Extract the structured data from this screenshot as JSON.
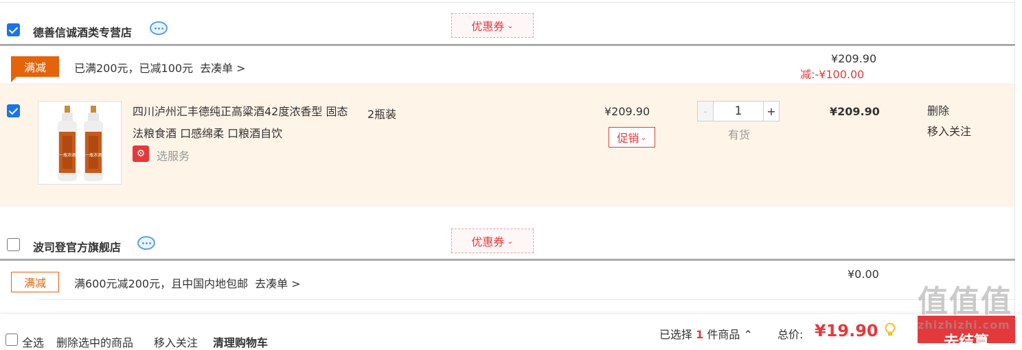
{
  "shops": [
    {
      "name": "德善信诚酒类专营店",
      "checked": true,
      "coupon_label": "优惠券",
      "promo": {
        "tag": "满减",
        "text": "已满200元，已减100元",
        "link": "去凑单 >",
        "subtotal": "¥209.90",
        "discount_label": "减:",
        "discount_value": "-¥100.00"
      },
      "item": {
        "checked": true,
        "name": "四川泸州汇丰德纯正高粱酒42度浓香型 固态法粮食酒 口感绵柔 口粮酒自饮",
        "service_label": "选服务",
        "spec": "2瓶装",
        "unit_price": "¥209.90",
        "promo_button": "促销",
        "quantity": "1",
        "dec": "-",
        "inc": "+",
        "stock": "有货",
        "sum": "¥209.90",
        "delete": "删除",
        "move_follow": "移入关注",
        "bottle_label": "一瓶浓酒"
      }
    },
    {
      "name": "波司登官方旗舰店",
      "checked": false,
      "coupon_label": "优惠券",
      "promo": {
        "tag": "满减",
        "text": "满600元减200元，且中国内地包邮",
        "link": "去凑单 >",
        "subtotal": "¥0.00"
      }
    }
  ],
  "footer": {
    "select_all": "全选",
    "delete_selected": "删除选中的商品",
    "move_follow": "移入关注",
    "clear_cart": "清理购物车",
    "selected_prefix": "已选择",
    "selected_count": "1",
    "selected_suffix": "件商品",
    "total_label": "总价:",
    "total_value": "¥19.90",
    "settle_button": "去结算"
  },
  "watermark": {
    "big": "值值值",
    "small": "zhizhizhi.com"
  },
  "colors": {
    "accent_red": "#e4393c",
    "promo_orange": "#e4630b",
    "item_bg": "#fff4e8",
    "checkbox_blue": "#1a73e8"
  }
}
